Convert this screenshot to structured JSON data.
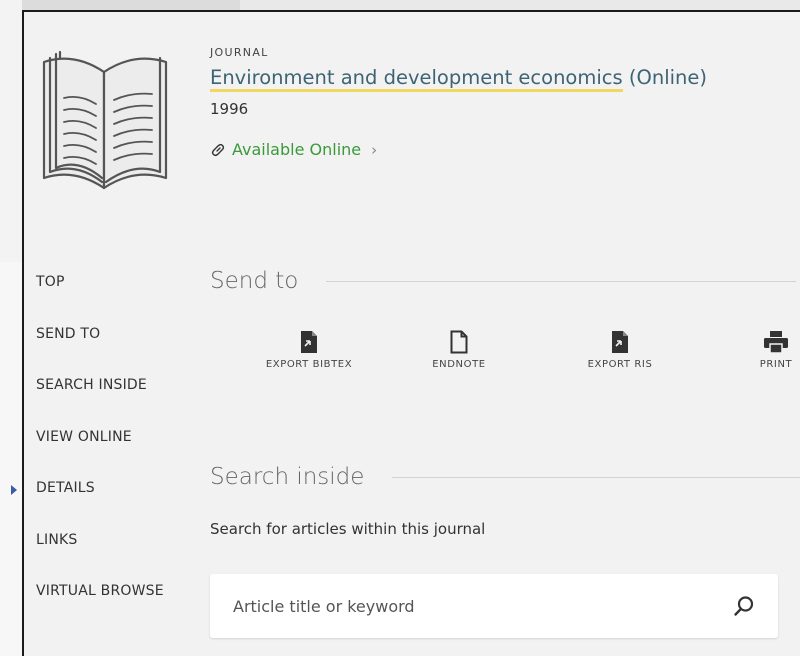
{
  "record": {
    "type": "JOURNAL",
    "title": "Environment and development economics",
    "title_suffix": "(Online)",
    "year": "1996",
    "availability": "Available Online"
  },
  "side_nav": {
    "items": [
      {
        "label": "TOP"
      },
      {
        "label": "SEND TO"
      },
      {
        "label": "SEARCH INSIDE"
      },
      {
        "label": "VIEW ONLINE"
      },
      {
        "label": "DETAILS"
      },
      {
        "label": "LINKS"
      },
      {
        "label": "VIRTUAL BROWSE"
      }
    ]
  },
  "send_to": {
    "heading": "Send to",
    "actions": [
      {
        "label": "EXPORT BIBTEX",
        "icon": "export-bibtex-icon"
      },
      {
        "label": "ENDNOTE",
        "icon": "endnote-icon"
      },
      {
        "label": "EXPORT RIS",
        "icon": "export-ris-icon"
      },
      {
        "label": "PRINT",
        "icon": "print-icon"
      }
    ]
  },
  "search_inside": {
    "heading": "Search inside",
    "description": "Search for articles within this journal",
    "placeholder": "Article title or keyword"
  },
  "colors": {
    "title": "#3d6474",
    "title_highlight": "#f0d75f",
    "availability": "#3a9a3a",
    "panel_bg": "#f2f2f2"
  }
}
